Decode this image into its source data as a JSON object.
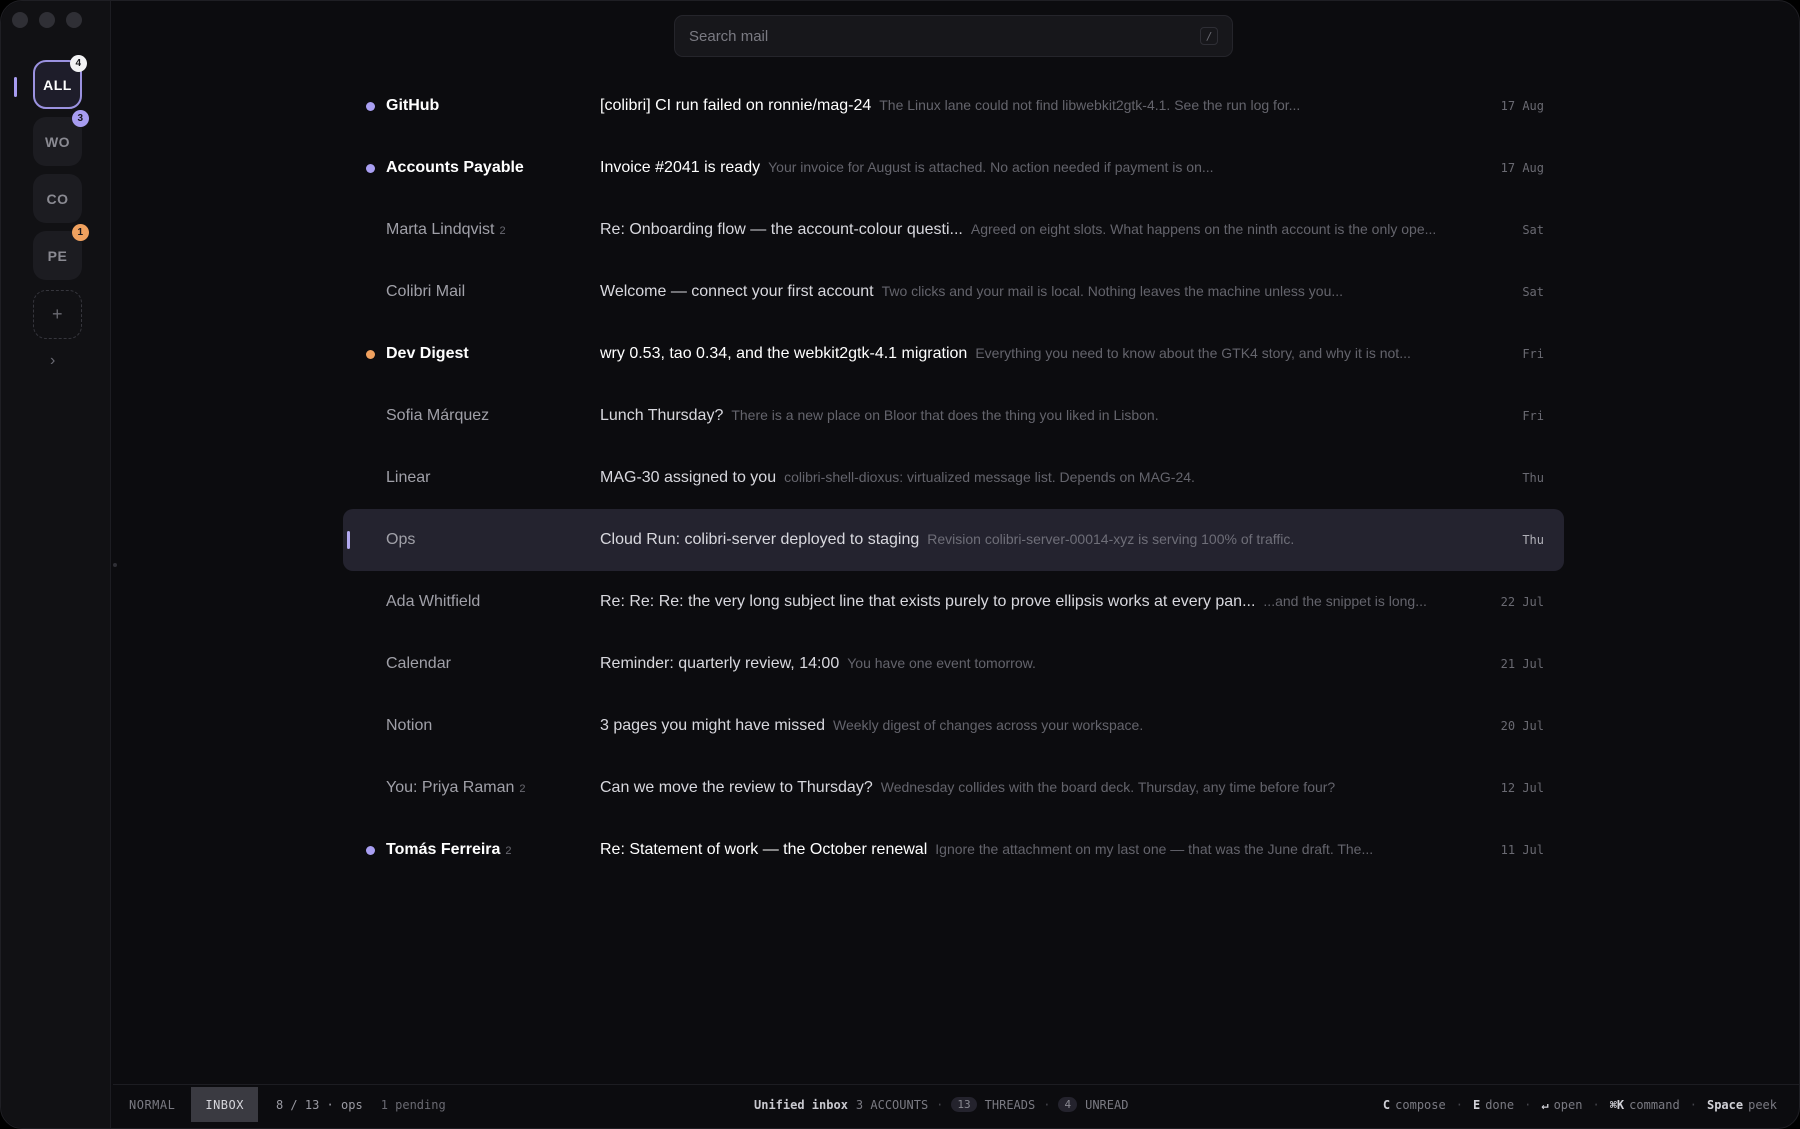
{
  "search": {
    "placeholder": "Search mail",
    "shortcut": "/"
  },
  "accounts": [
    {
      "label": "ALL",
      "badge": "4",
      "badge_color": "white",
      "active": true
    },
    {
      "label": "WO",
      "badge": "3",
      "badge_color": "purple"
    },
    {
      "label": "CO",
      "badge": ""
    },
    {
      "label": "PE",
      "badge": "1",
      "badge_color": "orange"
    }
  ],
  "sidebar": {
    "add_label": "+",
    "expand_label": "›"
  },
  "messages": [
    {
      "sender": "GitHub",
      "count": "",
      "subject": "[colibri] CI run failed on ronnie/mag-24",
      "snippet": "The Linux lane could not find libwebkit2gtk-4.1. See the run log for...",
      "date": "17 Aug",
      "unread": true,
      "dot": "purple"
    },
    {
      "sender": "Accounts Payable",
      "count": "",
      "subject": "Invoice #2041 is ready",
      "snippet": "Your invoice for August is attached. No action needed if payment is on...",
      "date": "17 Aug",
      "unread": true,
      "dot": "purple"
    },
    {
      "sender": "Marta Lindqvist",
      "count": "2",
      "subject": "Re: Onboarding flow — the account-colour questi...",
      "snippet": "Agreed on eight slots. What happens on the ninth account is the only ope...",
      "date": "Sat",
      "unread": false,
      "dot": ""
    },
    {
      "sender": "Colibri Mail",
      "count": "",
      "subject": "Welcome — connect your first account",
      "snippet": "Two clicks and your mail is local. Nothing leaves the machine unless you...",
      "date": "Sat",
      "unread": false,
      "dot": ""
    },
    {
      "sender": "Dev Digest",
      "count": "",
      "subject": "wry 0.53, tao 0.34, and the webkit2gtk-4.1 migration",
      "snippet": "Everything you need to know about the GTK4 story, and why it is not...",
      "date": "Fri",
      "unread": true,
      "dot": "orange"
    },
    {
      "sender": "Sofia Márquez",
      "count": "",
      "subject": "Lunch Thursday?",
      "snippet": "There is a new place on Bloor that does the thing you liked in Lisbon.",
      "date": "Fri",
      "unread": false,
      "dot": ""
    },
    {
      "sender": "Linear",
      "count": "",
      "subject": "MAG-30 assigned to you",
      "snippet": "colibri-shell-dioxus: virtualized message list. Depends on MAG-24.",
      "date": "Thu",
      "unread": false,
      "dot": ""
    },
    {
      "sender": "Ops",
      "count": "",
      "subject": "Cloud Run: colibri-server deployed to staging",
      "snippet": "Revision colibri-server-00014-xyz is serving 100% of traffic.",
      "date": "Thu",
      "unread": false,
      "dot": "",
      "selected": true
    },
    {
      "sender": "Ada Whitfield",
      "count": "",
      "subject": "Re: Re: Re: the very long subject line that exists purely to prove ellipsis works at every pan...",
      "snippet": "...and the snippet is long...",
      "date": "22 Jul",
      "unread": false,
      "dot": ""
    },
    {
      "sender": "Calendar",
      "count": "",
      "subject": "Reminder: quarterly review, 14:00",
      "snippet": "You have one event tomorrow.",
      "date": "21 Jul",
      "unread": false,
      "dot": ""
    },
    {
      "sender": "Notion",
      "count": "",
      "subject": "3 pages you might have missed",
      "snippet": "Weekly digest of changes across your workspace.",
      "date": "20 Jul",
      "unread": false,
      "dot": ""
    },
    {
      "sender": "You: Priya Raman",
      "count": "2",
      "subject": "Can we move the review to Thursday?",
      "snippet": "Wednesday collides with the board deck. Thursday, any time before four?",
      "date": "12 Jul",
      "unread": false,
      "dot": ""
    },
    {
      "sender": "Tomás Ferreira",
      "count": "2",
      "subject": "Re: Statement of work — the October renewal",
      "snippet": "Ignore the attachment on my last one — that was the June draft. The...",
      "date": "11 Jul",
      "unread": true,
      "dot": "purple"
    }
  ],
  "status": {
    "mode": "NORMAL",
    "view": "INBOX",
    "position": "8 / 13 · ops",
    "pending": "1 pending",
    "inbox_label": "Unified inbox",
    "accounts": "3 ACCOUNTS",
    "threads_count": "13",
    "threads_label": "THREADS",
    "unread_count": "4",
    "unread_label": "UNREAD",
    "hints": [
      {
        "key": "C",
        "label": "compose"
      },
      {
        "key": "E",
        "label": "done"
      },
      {
        "key": "↵",
        "label": "open"
      },
      {
        "key": "⌘K",
        "label": "command"
      },
      {
        "key": "Space",
        "label": "peek"
      }
    ]
  },
  "colors": {
    "accent": "#a99ff2",
    "orange": "#f0a15f",
    "background": "#0c0c0f",
    "selected_row": "#24232f"
  }
}
